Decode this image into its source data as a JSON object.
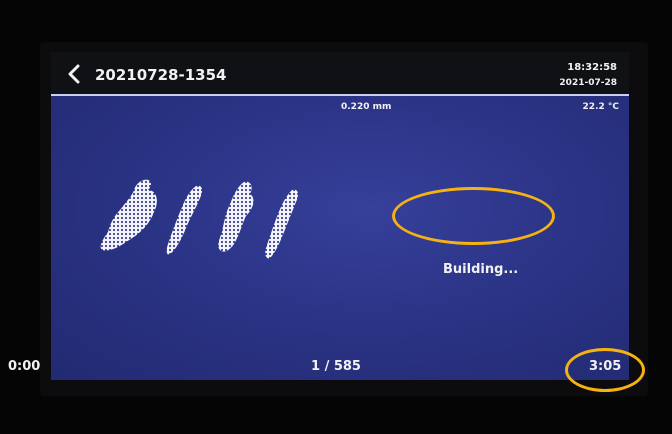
{
  "header": {
    "job_name": "20210728-1354",
    "time": "18:32:58",
    "date": "2021-07-28",
    "back_icon": "chevron-left-icon"
  },
  "canvas": {
    "layer_thickness": "0.220 mm",
    "temperature": "22.2 °C",
    "status": "Building..."
  },
  "footer": {
    "elapsed": "0:00",
    "layer_counter": "1 / 585",
    "remaining": "3:05"
  },
  "progress": {
    "current_layer": 1,
    "total_layers": 585
  },
  "colors": {
    "canvas_blue": "#2b3486",
    "annotation": "#f5b212",
    "text": "#f2f2f2"
  }
}
